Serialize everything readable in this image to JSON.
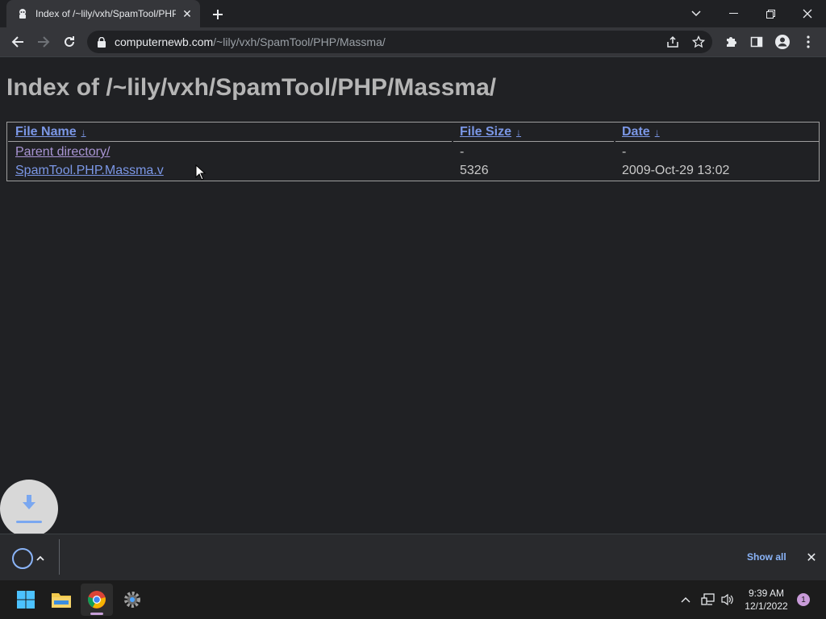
{
  "browser": {
    "tab_title": "Index of /~lily/vxh/SpamTool/PHP/Massma/",
    "url_host": "computernewb.com",
    "url_path": "/~lily/vxh/SpamTool/PHP/Massma/"
  },
  "page": {
    "heading": "Index of /~lily/vxh/SpamTool/PHP/Massma/",
    "columns": {
      "name": "File Name",
      "size": "File Size",
      "date": "Date",
      "sort_arrow": "↓"
    },
    "rows": [
      {
        "name": "Parent directory/",
        "size": "-",
        "date": "-"
      },
      {
        "name": "SpamTool.PHP.Massma.v",
        "size": "5326",
        "date": "2009-Oct-29 13:02"
      }
    ]
  },
  "downloads": {
    "show_all_label": "Show all"
  },
  "taskbar": {
    "time": "9:39 AM",
    "date": "12/1/2022",
    "notification_count": "1"
  },
  "colors": {
    "link": "#7b97e6",
    "visited_link": "#a995d4",
    "accent": "#8ab4f8",
    "background": "#202124"
  }
}
